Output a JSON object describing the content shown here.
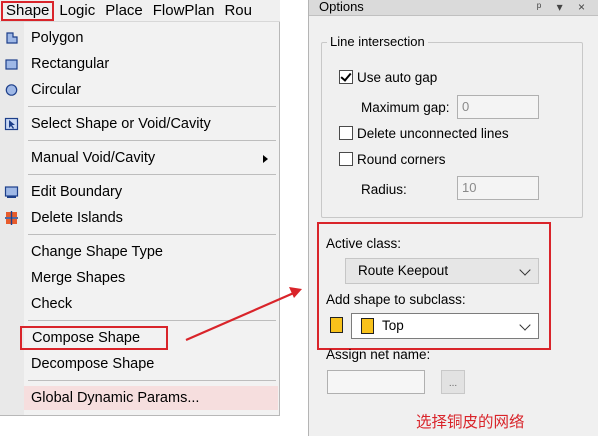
{
  "menubar": {
    "items": [
      "Shape",
      "Logic",
      "Place",
      "FlowPlan",
      "Rou"
    ]
  },
  "menu": {
    "items": [
      {
        "label": "Polygon",
        "icon": "polygon-icon"
      },
      {
        "label": "Rectangular",
        "icon": "rectangle-icon"
      },
      {
        "label": "Circular",
        "icon": "circle-icon"
      },
      {
        "label": "Select Shape or Void/Cavity",
        "icon": "select-shape-icon"
      },
      {
        "label": "Manual Void/Cavity",
        "submenu": true
      },
      {
        "label": "Edit Boundary",
        "icon": "edit-boundary-icon"
      },
      {
        "label": "Delete Islands",
        "icon": "delete-islands-icon"
      },
      {
        "label": "Change Shape Type"
      },
      {
        "label": "Merge Shapes"
      },
      {
        "label": "Check"
      },
      {
        "label": "Compose Shape"
      },
      {
        "label": "Decompose Shape"
      },
      {
        "label": "Global Dynamic Params..."
      }
    ]
  },
  "options": {
    "title": "Options",
    "line_intersection": {
      "legend": "Line intersection",
      "use_auto_gap": {
        "label": "Use auto gap",
        "checked": true
      },
      "maximum_gap": {
        "label": "Maximum gap:",
        "value": "0"
      },
      "delete_unconnected": {
        "label": "Delete unconnected lines",
        "checked": false
      },
      "round_corners": {
        "label": "Round corners",
        "checked": false
      },
      "radius": {
        "label": "Radius:",
        "value": "10"
      }
    },
    "active_class": {
      "label": "Active class:",
      "value": "Route Keepout"
    },
    "subclass": {
      "label": "Add shape to subclass:",
      "value": "Top",
      "color": "#f8c21b"
    },
    "assign_net": {
      "label": "Assign net name:",
      "value": "",
      "button": "..."
    }
  },
  "annotation": {
    "text": "选择铜皮的网络",
    "color": "#d9242a"
  },
  "colors": {
    "highlight_red": "#d9242a"
  }
}
